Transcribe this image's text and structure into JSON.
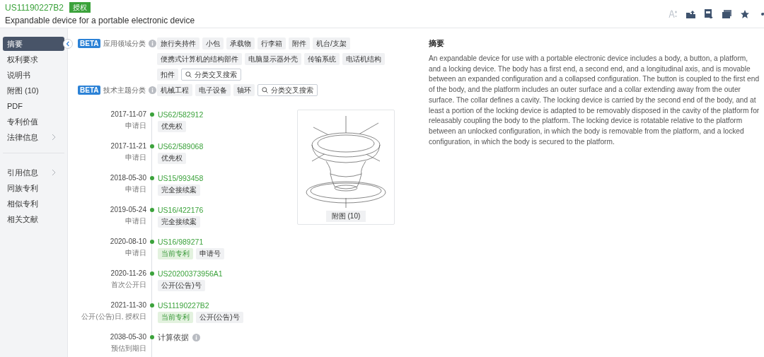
{
  "header": {
    "patent_number": "US11190227B2",
    "status": "授权",
    "title": "Expandable device for a portable electronic device"
  },
  "sidebar": {
    "groups": [
      {
        "items": [
          {
            "label": "摘要",
            "selected": true,
            "has_submenu": false
          },
          {
            "label": "权利要求",
            "selected": false,
            "has_submenu": false
          },
          {
            "label": "说明书",
            "selected": false,
            "has_submenu": false
          },
          {
            "label": "附图 (10)",
            "selected": false,
            "has_submenu": false
          },
          {
            "label": "PDF",
            "selected": false,
            "has_submenu": false
          },
          {
            "label": "专利价值",
            "selected": false,
            "has_submenu": false
          },
          {
            "label": "法律信息",
            "selected": false,
            "has_submenu": true
          }
        ]
      },
      {
        "items": [
          {
            "label": "引用信息",
            "selected": false,
            "has_submenu": true
          },
          {
            "label": "同族专利",
            "selected": false,
            "has_submenu": false
          },
          {
            "label": "相似专利",
            "selected": false,
            "has_submenu": false
          },
          {
            "label": "相关文献",
            "selected": false,
            "has_submenu": false
          }
        ]
      }
    ]
  },
  "classifications": [
    {
      "badge": "BETA",
      "label": "应用领域分类",
      "tags": [
        "旅行夹持件",
        "小包",
        "承载物",
        "行李箱",
        "附件",
        "机台/支架",
        "便携式计算机的结构部件",
        "电脑显示器外壳",
        "传输系统",
        "电话机结构",
        "扣件"
      ],
      "search_button": "分类交叉搜索"
    },
    {
      "badge": "BETA",
      "label": "技术主题分类",
      "tags": [
        "机械工程",
        "电子设备",
        "轴环"
      ],
      "search_button": "分类交叉搜索"
    }
  ],
  "timeline": [
    {
      "date": "2017-11-07",
      "date_label": "申请日",
      "number": "US62/582912",
      "tags": [
        {
          "text": "优先权",
          "kind": "plain"
        }
      ]
    },
    {
      "date": "2017-11-21",
      "date_label": "申请日",
      "number": "US62/589068",
      "tags": [
        {
          "text": "优先权",
          "kind": "plain"
        }
      ]
    },
    {
      "date": "2018-05-30",
      "date_label": "申请日",
      "number": "US15/993458",
      "tags": [
        {
          "text": "完全接续案",
          "kind": "plain"
        }
      ]
    },
    {
      "date": "2019-05-24",
      "date_label": "申请日",
      "number": "US16/422176",
      "tags": [
        {
          "text": "完全接续案",
          "kind": "plain"
        }
      ]
    },
    {
      "date": "2020-08-10",
      "date_label": "申请日",
      "number": "US16/989271",
      "tags": [
        {
          "text": "当前专利",
          "kind": "current"
        },
        {
          "text": "申请号",
          "kind": "plain"
        }
      ]
    },
    {
      "date": "2020-11-26",
      "date_label": "首次公开日",
      "number": "US20200373956A1",
      "tags": [
        {
          "text": "公开(公告)号",
          "kind": "plain"
        }
      ]
    },
    {
      "date": "2021-11-30",
      "date_label": "公开(公告)日, 授权日",
      "number": "US11190227B2",
      "tags": [
        {
          "text": "当前专利",
          "kind": "current"
        },
        {
          "text": "公开(公告)号",
          "kind": "plain"
        }
      ]
    },
    {
      "date": "2038-05-30",
      "date_label": "预估到期日",
      "note": "计算依据"
    }
  ],
  "figure": {
    "caption": "附图 (10)"
  },
  "abstract": {
    "heading": "摘要",
    "text": "An expandable device for use with a portable electronic device includes a body, a button, a platform, and a locking device. The body has a first end, a second end, and a longitudinal axis, and is movable between an expanded configuration and a collapsed configuration. The button is coupled to the first end of the body, and the platform includes an outer surface and a collar extending away from the outer surface. The collar defines a cavity. The locking device is carried by the second end of the body, and at least a portion of the locking device is adapted to be removably disposed in the cavity of the platform for releasably coupling the body to the platform. The locking device is rotatable relative to the platform between an unlocked configuration, in which the body is removable from the platform, and a locked configuration, in which the body is secured to the platform."
  }
}
